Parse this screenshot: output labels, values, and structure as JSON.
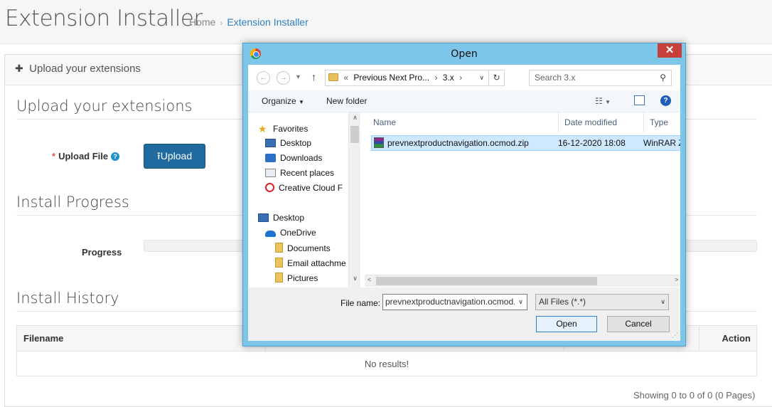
{
  "page": {
    "title": "Extension Installer",
    "breadcrumb": {
      "home": "Home",
      "separator": "›",
      "current": "Extension Installer"
    }
  },
  "panel": {
    "heading": "Upload your extensions",
    "upload_section": {
      "title": "Upload your extensions",
      "upload_file_label": "Upload File",
      "required_mark": "*",
      "help_icon": "question-circle-icon",
      "upload_button": "Upload"
    },
    "progress_section": {
      "title": "Install Progress",
      "progress_label": "Progress",
      "progress_value": 0
    },
    "history_section": {
      "title": "Install History",
      "columns": [
        "Filename",
        "",
        "",
        "Action"
      ],
      "empty_text": "No results!",
      "showing": "Showing 0 to 0 of 0 (0 Pages)"
    }
  },
  "dialog": {
    "title": "Open",
    "close": "✕",
    "nav": {
      "back": "←",
      "forward": "→",
      "up": "↑",
      "address_prefix": "«",
      "address": "Previous Next Pro...",
      "address_sep": "›",
      "address_leaf": "3.x",
      "address_sep2": "›",
      "refresh": "↻",
      "search_placeholder": "Search 3.x"
    },
    "toolbar": {
      "organize": "Organize",
      "new_folder": "New folder"
    },
    "tree": [
      {
        "label": "Favorites",
        "icon": "star-icon"
      },
      {
        "label": "Desktop",
        "icon": "desktop-icon"
      },
      {
        "label": "Downloads",
        "icon": "downloads-icon"
      },
      {
        "label": "Recent places",
        "icon": "recent-places-icon"
      },
      {
        "label": "Creative Cloud F",
        "icon": "creative-cloud-icon"
      },
      {
        "label": "Desktop",
        "icon": "desktop-icon"
      },
      {
        "label": "OneDrive",
        "icon": "onedrive-icon"
      },
      {
        "label": "Documents",
        "icon": "folder-icon"
      },
      {
        "label": "Email attachme",
        "icon": "folder-icon"
      },
      {
        "label": "Pictures",
        "icon": "folder-icon"
      }
    ],
    "columns": [
      "Name",
      "Date modified",
      "Type"
    ],
    "files": [
      {
        "name": "prevnextproductnavigation.ocmod.zip",
        "date": "16-12-2020 18:08",
        "type": "WinRAR Z"
      }
    ],
    "file_name_label": "File name:",
    "file_name_value": "prevnextproductnavigation.ocmod.zip",
    "filter": "All Files (*.*)",
    "open_button": "Open",
    "cancel_button": "Cancel"
  }
}
